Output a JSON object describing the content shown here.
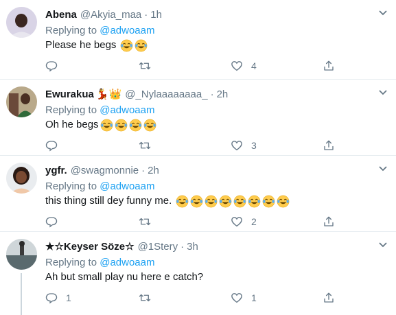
{
  "tweets": [
    {
      "name": "Abena",
      "name_emoji": "",
      "handle": "@Akyia_maa",
      "time": "1h",
      "replying_label": "Replying to",
      "replying_to": "@adwoaam",
      "text": "Please he begs",
      "emoji_count": 2,
      "reply_count": "",
      "retweet_count": "",
      "like_count": "4"
    },
    {
      "name": "Ewurakua",
      "name_emoji": "💃👑",
      "handle": "@_Nylaaaaaaaa_",
      "time": "2h",
      "replying_label": "Replying to",
      "replying_to": "@adwoaam",
      "text": "Oh he begs",
      "emoji_count": 4,
      "reply_count": "",
      "retweet_count": "",
      "like_count": "3"
    },
    {
      "name": "ygfr.",
      "name_emoji": "",
      "handle": "@swagmonnie",
      "time": "2h",
      "replying_label": "Replying to",
      "replying_to": "@adwoaam",
      "text": "this thing still dey funny me.",
      "emoji_count": 8,
      "reply_count": "",
      "retweet_count": "",
      "like_count": "2"
    },
    {
      "name": "★☆Keyser Söze☆",
      "name_emoji": "",
      "handle": "@1Stery",
      "time": "3h",
      "replying_label": "Replying to",
      "replying_to": "@adwoaam",
      "text": "Ah but small play nu here e catch?",
      "emoji_count": 0,
      "reply_count": "1",
      "retweet_count": "",
      "like_count": "1"
    }
  ],
  "dot": "·",
  "icons": {
    "reply": "reply-icon",
    "retweet": "retweet-icon",
    "like": "heart-icon",
    "share": "share-icon",
    "more": "chevron-down-icon",
    "emoji": "face-with-tears-of-joy-emoji"
  },
  "colors": {
    "mention": "#1da1f2",
    "secondary_text": "#657786",
    "primary_text": "#14171a",
    "divider": "#e6ecf0",
    "thread_line": "#ccd6dd"
  }
}
